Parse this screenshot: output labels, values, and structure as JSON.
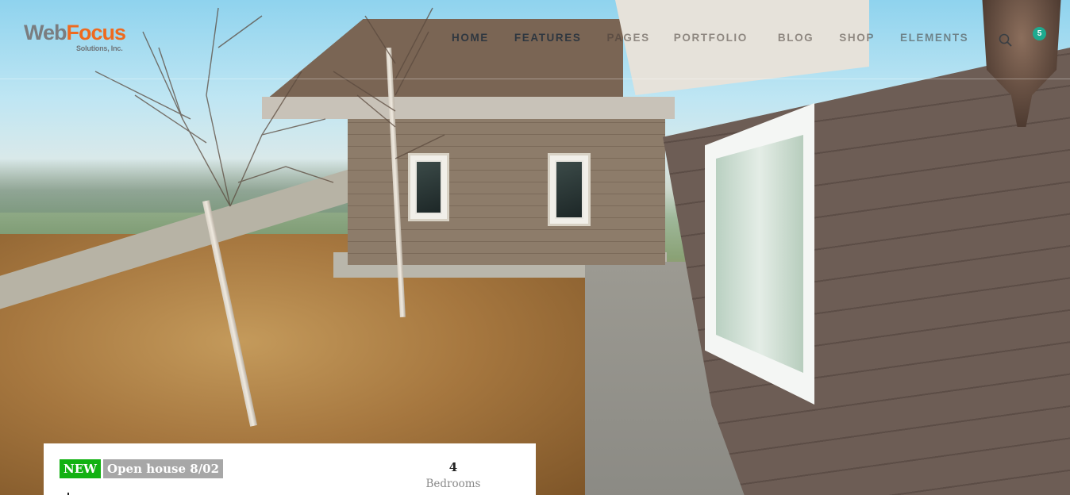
{
  "brand": {
    "logo_web": "Web",
    "logo_focus": "Focus",
    "logo_sub": "Solutions, Inc."
  },
  "nav": {
    "items": [
      {
        "label": "HOME"
      },
      {
        "label": "FEATURES"
      },
      {
        "label": "PAGES"
      },
      {
        "label": "PORTFOLIO"
      },
      {
        "label": "BLOG"
      },
      {
        "label": "SHOP"
      },
      {
        "label": "ELEMENTS"
      }
    ],
    "search_icon": "search-icon",
    "cart_count": "5"
  },
  "listing": {
    "badge_new": "NEW",
    "badge_open_house": "Open house 8/02",
    "bedrooms_value": "4",
    "bedrooms_label": "Bedrooms"
  },
  "colors": {
    "accent_orange": "#ee6a1f",
    "badge_new_green": "#12b112",
    "badge_gray": "#a7a7a7",
    "cart_teal": "#1eaa8f",
    "nav_text": "#2f3740"
  }
}
